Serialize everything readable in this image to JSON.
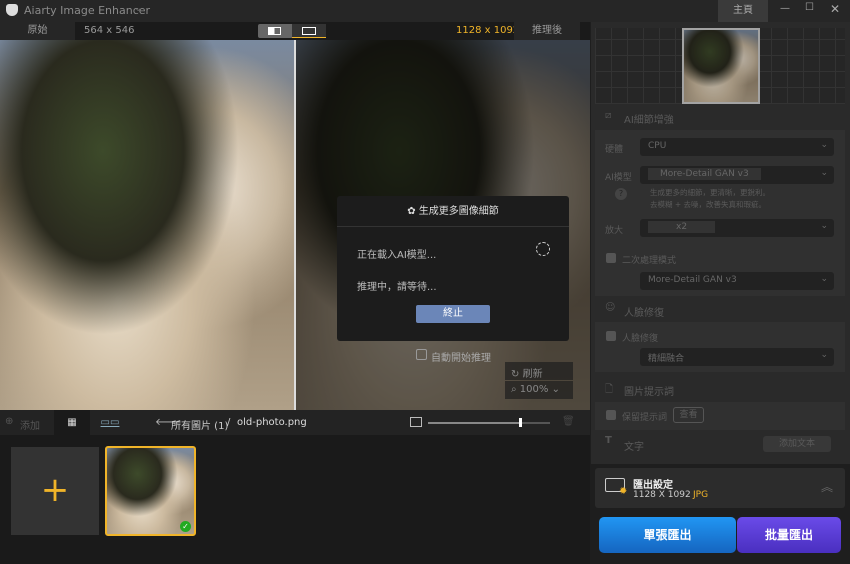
{
  "app": {
    "title": "Aiarty Image Enhancer",
    "home": "主頁"
  },
  "topbar": {
    "original": "原始",
    "orig_size": "564 x 546",
    "out_size": "1128 x 1092",
    "after": "推理後"
  },
  "dialog": {
    "title": "生成更多圖像細節",
    "loading": "正在載入AI模型...",
    "inferring": "推理中，請等待...",
    "stop": "終止",
    "auto_start": "自動開始推理",
    "refresh": "刷新",
    "zoom": "100%"
  },
  "bottombar": {
    "add": "添加",
    "breadcrumb_all": "所有圖片 (1)",
    "sep": "/",
    "filename": "old-photo.png",
    "thumb_size_percent": 75
  },
  "panel": {
    "ai_section": "AI細節增強",
    "hardware_label": "硬體",
    "hardware": "CPU",
    "model_label": "AI模型",
    "model": "More-Detail GAN  v3",
    "model_desc1": "生成更多的細節，更清晰，更銳利。",
    "model_desc2": "去模糊 + 去噪，改善失真和瑕疵。",
    "scale_label": "放大",
    "scale": "x2",
    "second_pass": "二次處理模式",
    "second_model": "More-Detail GAN  v3",
    "face_section": "人臉修復",
    "face_check": "人臉修復",
    "face_mode": "精細融合",
    "prompt_section": "圖片提示詞",
    "keep_prompt": "保留提示詞",
    "view": "查看",
    "text_section": "文字",
    "add_text": "添加文本",
    "export_title": "匯出設定",
    "export_size": "1128 X 1092",
    "export_format": "JPG",
    "single_export": "單張匯出",
    "batch_export": "批量匯出"
  },
  "colors": {
    "accent": "#f0b429",
    "blue": "#1e88e5",
    "purple": "#5a3fd8"
  }
}
